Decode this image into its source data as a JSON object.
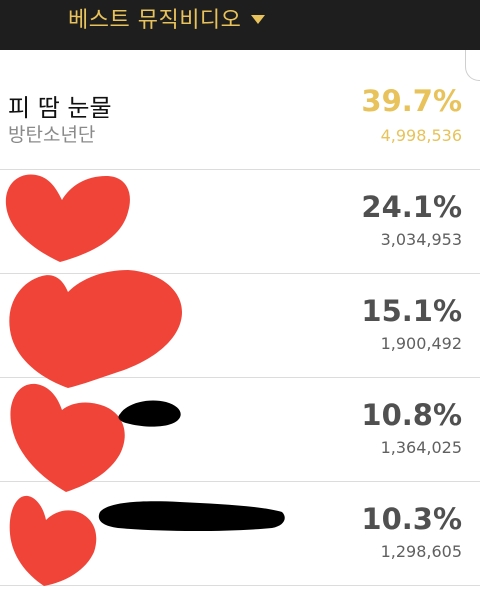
{
  "header": {
    "title": "베스트 뮤직비디오"
  },
  "rows": [
    {
      "title": "피 땀 눈물",
      "artist": "방탄소년단",
      "percent": "39.7%",
      "count": "4,998,536"
    },
    {
      "title": "",
      "artist": "",
      "percent": "24.1%",
      "count": "3,034,953"
    },
    {
      "title": "",
      "artist": "",
      "percent": "15.1%",
      "count": "1,900,492"
    },
    {
      "title": "",
      "artist": "",
      "percent": "10.8%",
      "count": "1,364,025"
    },
    {
      "title": "",
      "artist": "",
      "percent": "10.3%",
      "count": "1,298,605"
    }
  ],
  "colors": {
    "accent": "#e8c25a",
    "header_bg": "#1e1e1e",
    "redaction_red": "#f04438",
    "redaction_black": "#000000"
  }
}
